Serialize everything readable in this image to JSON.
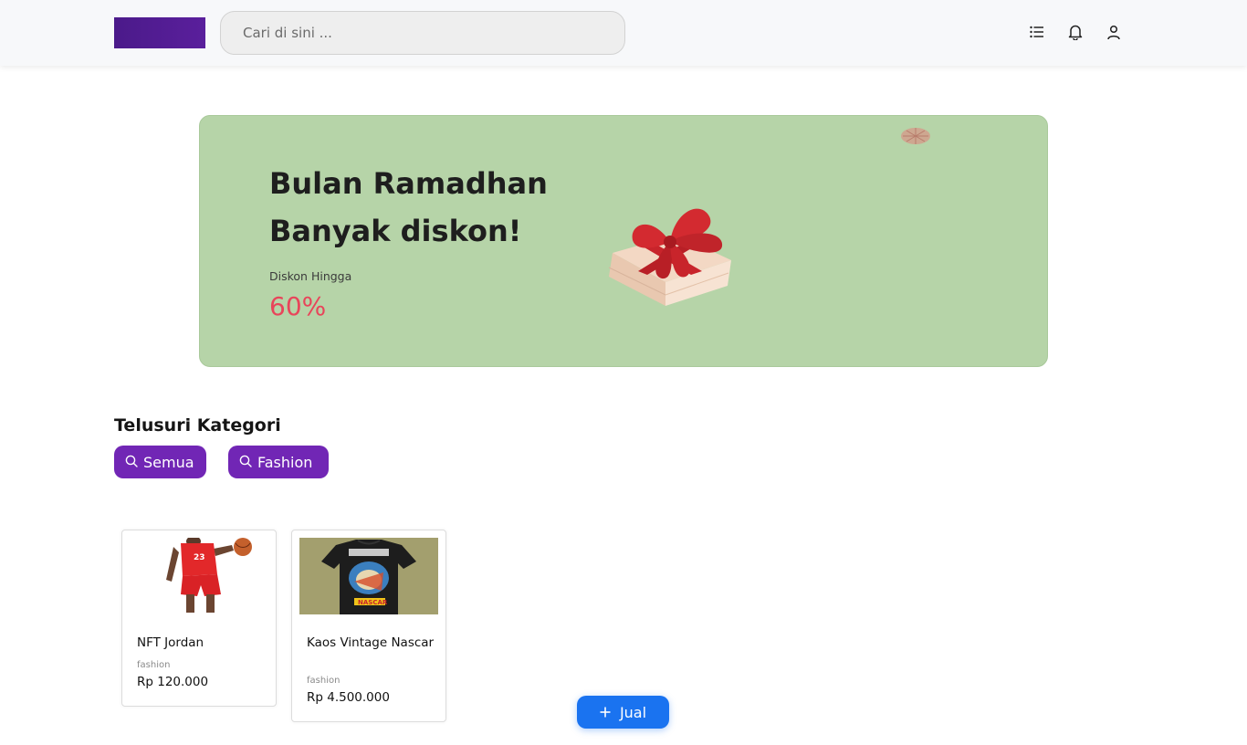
{
  "header": {
    "search_placeholder": "Cari di sini ...",
    "icons": [
      "list-icon",
      "bell-icon",
      "user-icon"
    ],
    "logo_color": "#4b1a8a"
  },
  "banner": {
    "title_line1": "Bulan Ramadhan",
    "title_line2": "Banyak diskon!",
    "subtitle": "Diskon Hingga",
    "percent": "60%",
    "background": "#b6d4a8",
    "percent_color": "#e8455a"
  },
  "categories": {
    "title": "Telusuri Kategori",
    "chips": [
      {
        "label": "Semua",
        "icon": "search-icon"
      },
      {
        "label": "Fashion",
        "icon": "search-icon"
      }
    ],
    "chip_color": "#7126b5"
  },
  "products": [
    {
      "title": "NFT Jordan",
      "category": "fashion",
      "price": "Rp 120.000"
    },
    {
      "title": "Kaos Vintage Nascar",
      "category": "fashion",
      "price": "Rp 4.500.000"
    }
  ],
  "sell_button": {
    "label": "Jual",
    "icon": "plus-icon",
    "color": "#1a73f0"
  }
}
